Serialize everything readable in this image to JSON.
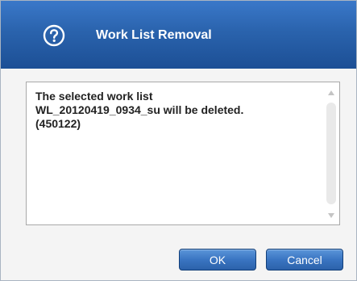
{
  "dialog": {
    "title": "Work List Removal",
    "icon": "question-help-icon",
    "message": "The selected work list\nWL_20120419_0934_su will be deleted.\n(450122)",
    "buttons": {
      "ok_label": "OK",
      "cancel_label": "Cancel"
    }
  },
  "colors": {
    "titlebar": "#2a63ad",
    "button": "#3a75c2",
    "body": "#f4f4f4"
  }
}
